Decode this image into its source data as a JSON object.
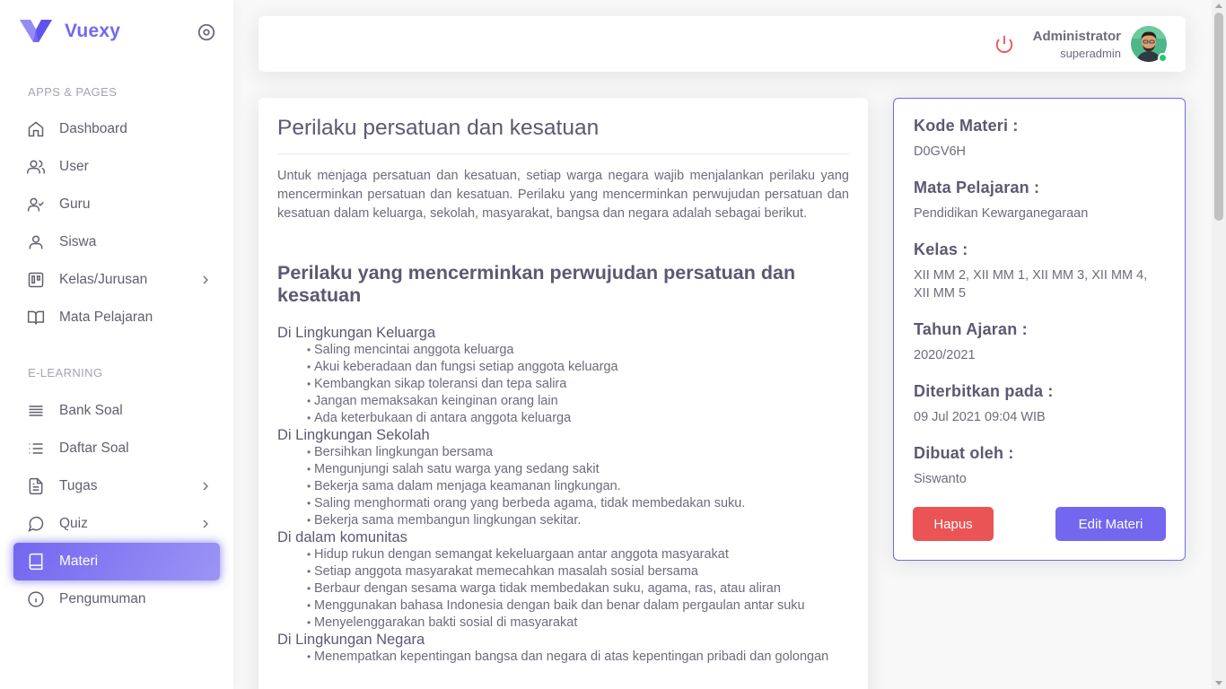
{
  "brand": {
    "name": "Vuexy"
  },
  "colors": {
    "primary": "#7367f0",
    "danger": "#ea5455",
    "online": "#28c76f"
  },
  "sidebar": {
    "section_apps": "APPS & PAGES",
    "section_elearning": "E-LEARNING",
    "items": [
      {
        "label": "Dashboard",
        "icon": "home-icon"
      },
      {
        "label": "User",
        "icon": "users-icon"
      },
      {
        "label": "Guru",
        "icon": "user-check-icon"
      },
      {
        "label": "Siswa",
        "icon": "user-icon"
      },
      {
        "label": "Kelas/Jurusan",
        "icon": "trello-icon",
        "has_children": true
      },
      {
        "label": "Mata Pelajaran",
        "icon": "book-open-icon"
      },
      {
        "label": "Bank Soal",
        "icon": "align-justify-icon"
      },
      {
        "label": "Daftar Soal",
        "icon": "list-icon"
      },
      {
        "label": "Tugas",
        "icon": "file-text-icon",
        "has_children": true
      },
      {
        "label": "Quiz",
        "icon": "message-circle-icon",
        "has_children": true
      },
      {
        "label": "Materi",
        "icon": "book-icon",
        "active": true
      },
      {
        "label": "Pengumuman",
        "icon": "info-icon"
      }
    ]
  },
  "navbar": {
    "user_name": "Administrator",
    "user_role": "superadmin"
  },
  "content": {
    "title": "Perilaku persatuan dan kesatuan",
    "intro": "Untuk menjaga persatuan dan kesatuan, setiap warga negara wajib menjalankan perilaku yang mencerminkan persatuan dan kesatuan. Perilaku yang mencerminkan perwujudan persatuan dan kesatuan dalam keluarga, sekolah, masyarakat, bangsa dan negara adalah sebagai berikut.",
    "subtitle": "Perilaku yang mencerminkan perwujudan persatuan dan kesatuan",
    "sections": [
      {
        "heading": "Di Lingkungan Keluarga",
        "items": [
          "Saling mencintai anggota keluarga",
          "Akui keberadaan dan fungsi setiap anggota keluarga",
          "Kembangkan sikap toleransi dan tepa salira",
          "Jangan memaksakan keinginan orang lain",
          "Ada keterbukaan di antara anggota keluarga"
        ]
      },
      {
        "heading": "Di Lingkungan Sekolah",
        "items": [
          "Bersihkan lingkungan bersama",
          "Mengunjungi salah satu warga yang sedang sakit",
          "Bekerja sama dalam menjaga keamanan lingkungan.",
          "Saling menghormati orang yang berbeda agama, tidak membedakan suku.",
          "Bekerja sama membangun lingkungan sekitar."
        ]
      },
      {
        "heading": "Di dalam komunitas",
        "items": [
          "Hidup rukun dengan semangat kekeluargaan antar anggota masyarakat",
          "Setiap anggota masyarakat memecahkan masalah sosial bersama",
          "Berbaur dengan sesama warga tidak membedakan suku, agama, ras, atau aliran",
          "Menggunakan bahasa Indonesia dengan baik dan benar dalam pergaulan antar suku",
          "Menyelenggarakan bakti sosial di masyarakat"
        ]
      },
      {
        "heading": "Di Lingkungan Negara",
        "items": [
          "Menempatkan kepentingan bangsa dan negara di atas kepentingan pribadi dan golongan"
        ]
      }
    ]
  },
  "info": {
    "kode_label": "Kode Materi :",
    "kode_value": "D0GV6H",
    "mapel_label": "Mata Pelajaran :",
    "mapel_value": "Pendidikan Kewarganegaraan",
    "kelas_label": "Kelas :",
    "kelas_value": "XII MM 2, XII MM 1, XII MM 3, XII MM 4, XII MM 5",
    "tahun_label": "Tahun Ajaran :",
    "tahun_value": "2020/2021",
    "terbit_label": "Diterbitkan pada :",
    "terbit_value": "09 Jul 2021 09:04 WIB",
    "dibuat_label": "Dibuat oleh :",
    "dibuat_value": "Siswanto",
    "delete_label": "Hapus",
    "edit_label": "Edit Materi"
  }
}
